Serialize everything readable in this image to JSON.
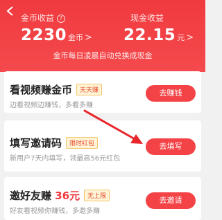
{
  "header": {
    "back_icon": "chevron-left-icon",
    "gold_label": "金币收益",
    "gold_help_icon": "question-circle-icon",
    "gold_help_glyph": "?",
    "gold_amount": "2230",
    "gold_unit": "金币",
    "gold_chevron": ">",
    "cash_label": "现金收益",
    "cash_amount": "22.15",
    "cash_unit": "元",
    "cash_chevron": ">",
    "notice": "金币每日凌晨自动兑换成现金",
    "bg_color": "#f03a3f"
  },
  "tasks": [
    {
      "title": "看视频赚金币",
      "badge": "天天赚",
      "subtitle": "边看视频边赚钱，多看多赚",
      "button": "去赚钱"
    },
    {
      "title": "填写邀请码",
      "badge": "限时红包",
      "subtitle": "新用户7天内填写，领最高56元红包",
      "button": "去填写"
    },
    {
      "title": "邀好友赚",
      "title_amount": "36元",
      "badge": "无上限",
      "subtitle": "好友看视频你赚钱，多邀多赚",
      "button": "去邀请"
    }
  ],
  "annotation": {
    "arrow_icon": "red-arrow-annotation",
    "color": "#e8262b"
  },
  "button_color": "#f44347"
}
